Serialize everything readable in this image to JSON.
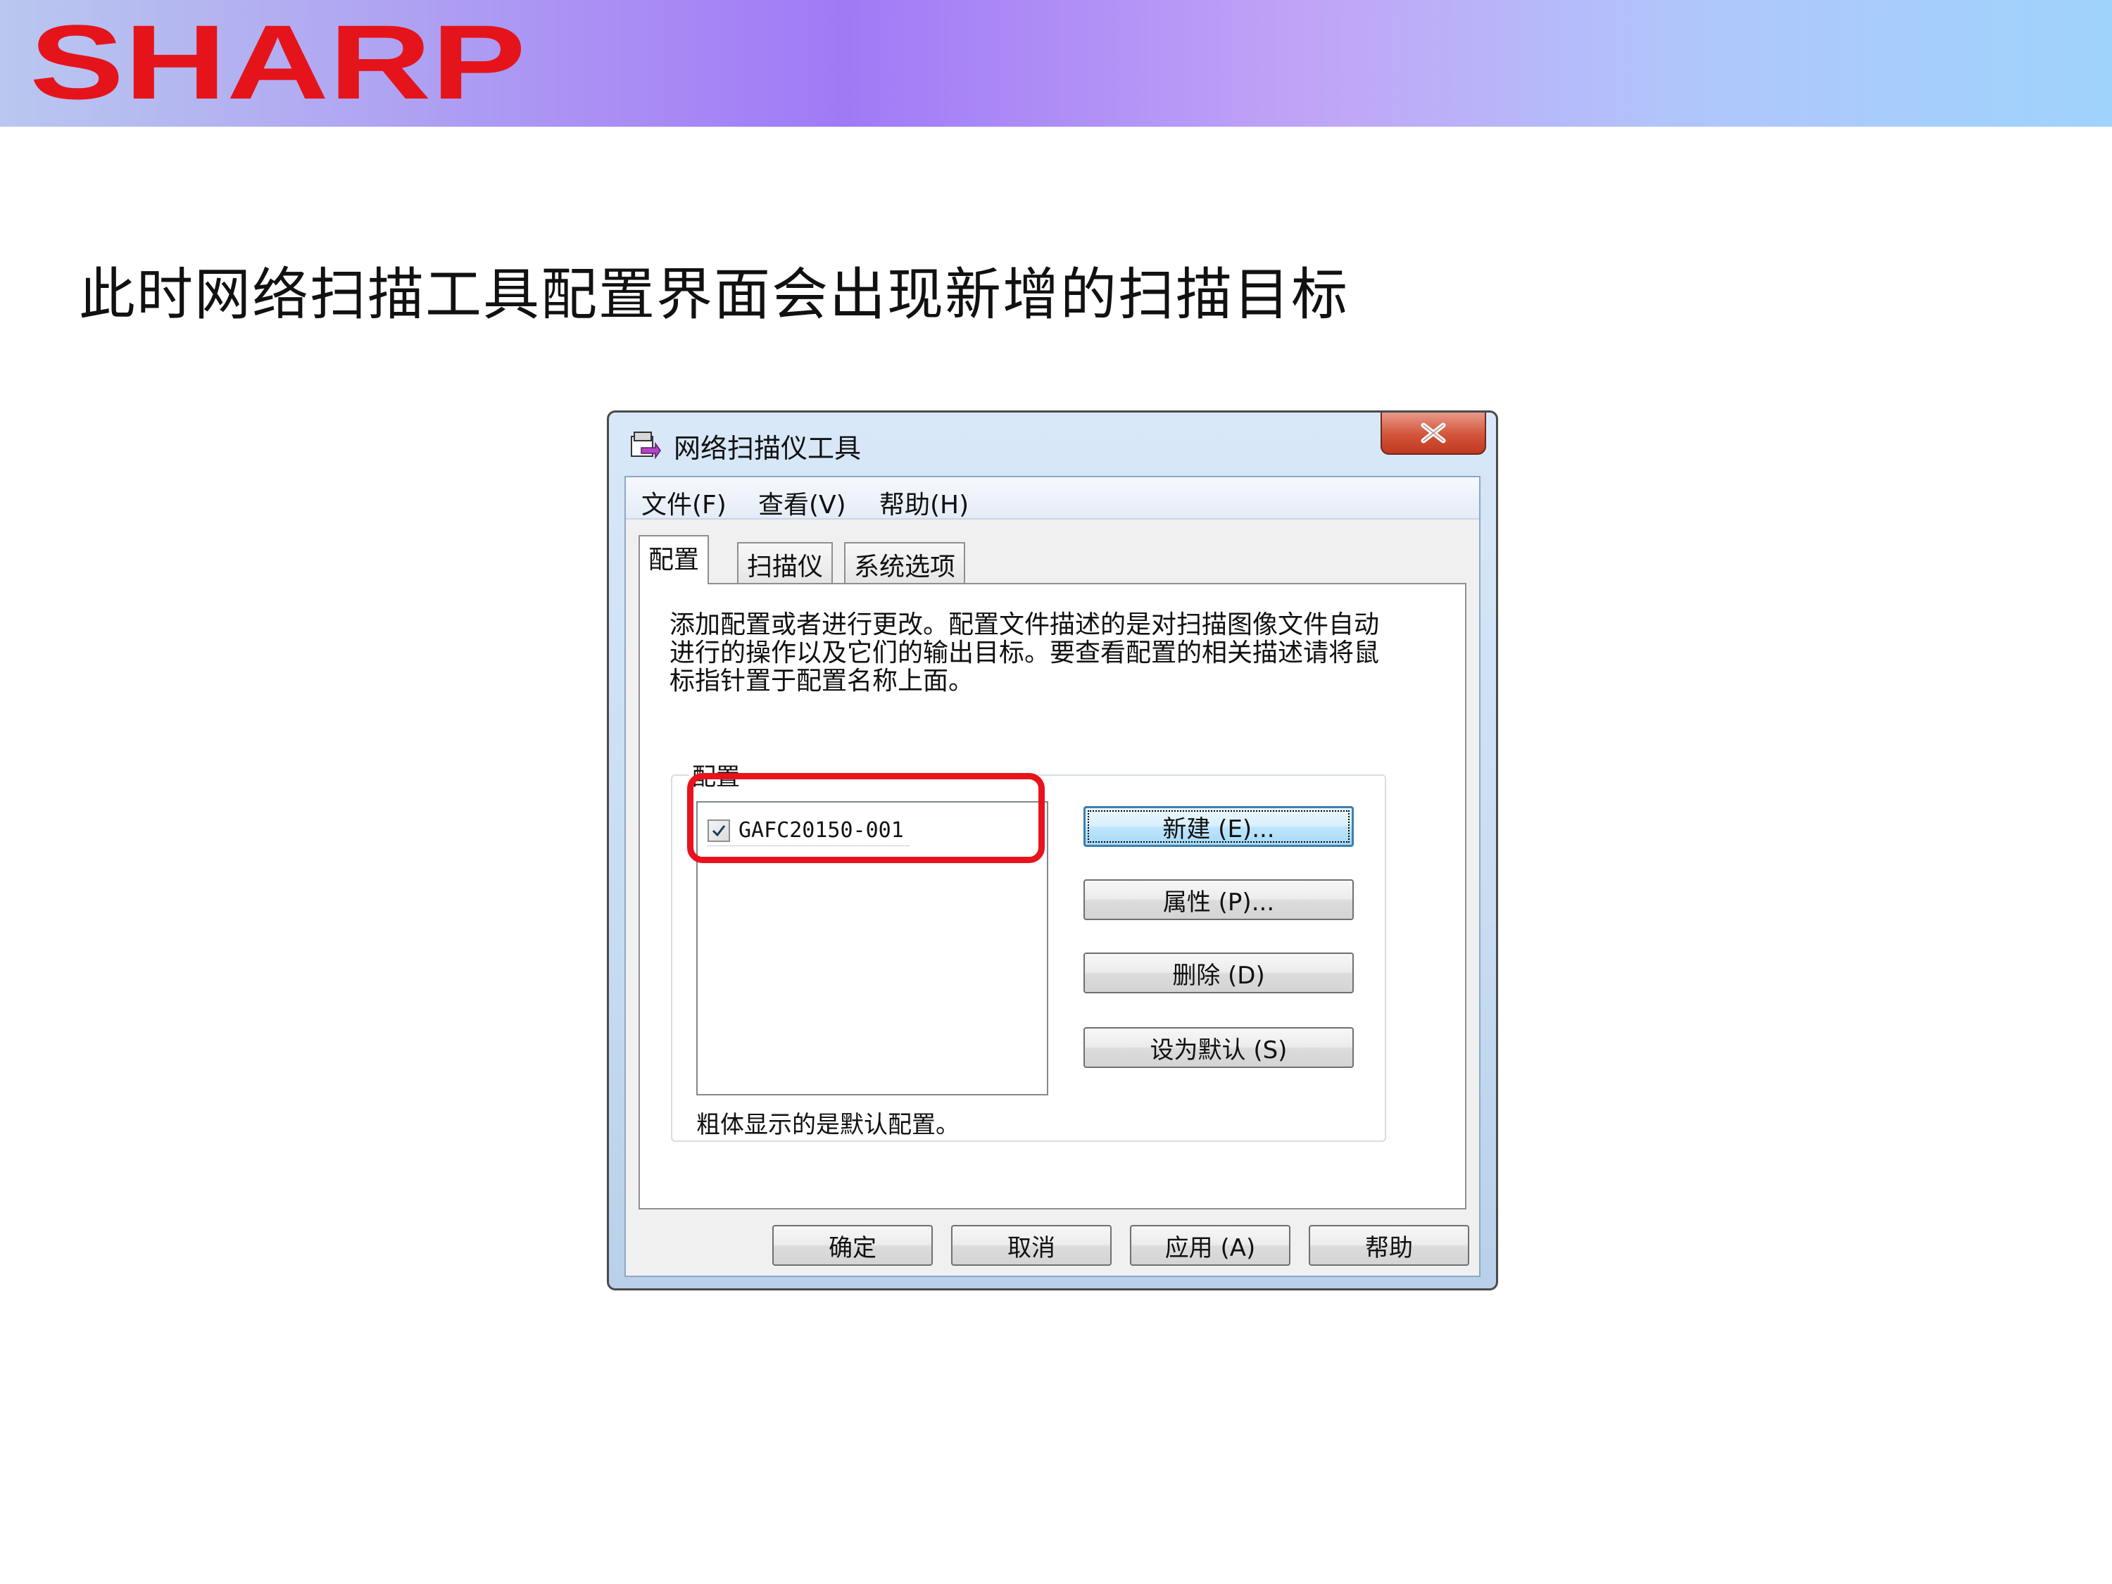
{
  "slide": {
    "logo_text": "SHARP",
    "title": "此时网络扫描工具配置界面会出现新增的扫描目标",
    "colors": {
      "logo_red": "#e5141b",
      "highlight_red": "#e8131c"
    }
  },
  "window": {
    "title": "网络扫描仪工具",
    "menu": [
      "文件(F)",
      "查看(V)",
      "帮助(H)"
    ],
    "tabs": [
      "配置",
      "扫描仪",
      "系统选项"
    ],
    "active_tab": "配置",
    "description": "添加配置或者进行更改。配置文件描述的是对扫描图像文件自动进行的操作以及它们的输出目标。要查看配置的相关描述请将鼠标指针置于配置名称上面。",
    "group": {
      "label": "配置",
      "profiles": [
        {
          "name": "GAFC20150-001",
          "checked": true
        }
      ],
      "footnote": "粗体显示的是默认配置。"
    },
    "side_buttons": {
      "new": "新建 (E)...",
      "properties": "属性 (P)...",
      "delete": "删除 (D)",
      "set_default": "设为默认 (S)"
    },
    "bottom_buttons": {
      "ok": "确定",
      "cancel": "取消",
      "apply": "应用 (A)",
      "help": "帮助"
    }
  }
}
